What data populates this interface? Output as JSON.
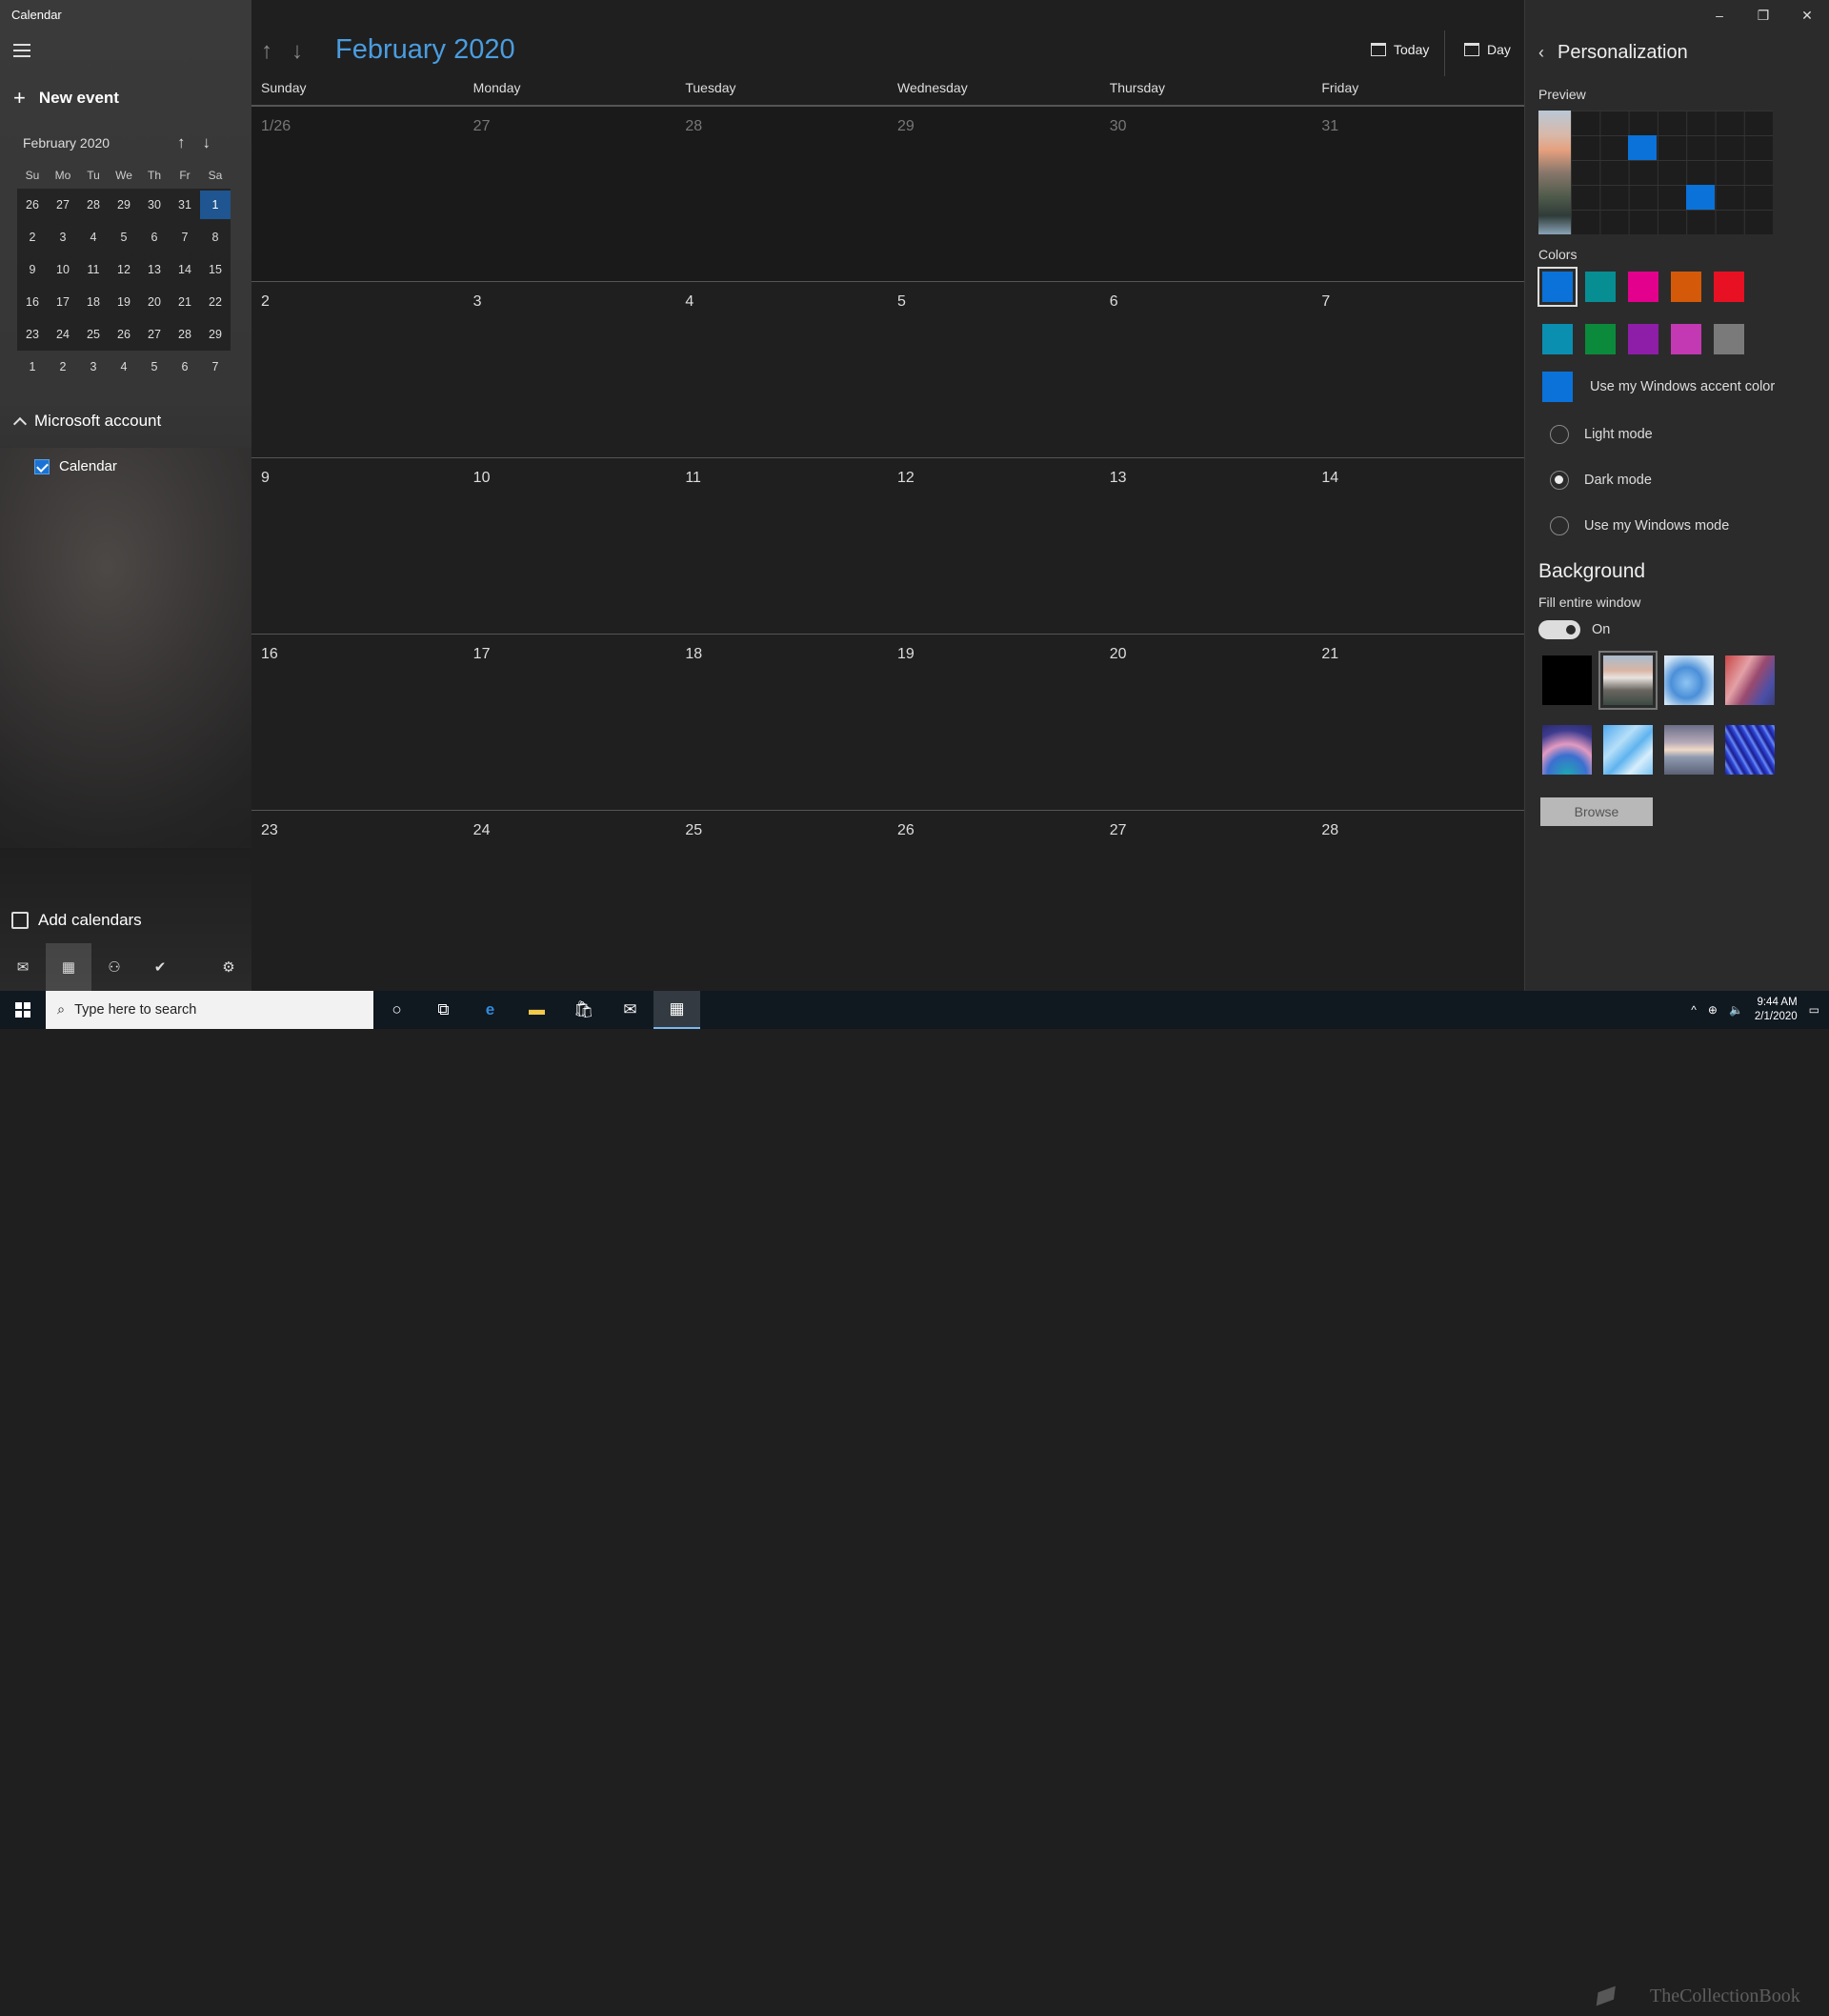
{
  "app": {
    "title": "Calendar"
  },
  "left": {
    "new_event": "New event",
    "mini_title": "February 2020",
    "weekday_abbr": [
      "Su",
      "Mo",
      "Tu",
      "We",
      "Th",
      "Fr",
      "Sa"
    ],
    "mini_weeks": [
      [
        "26",
        "27",
        "28",
        "29",
        "30",
        "31",
        "1"
      ],
      [
        "2",
        "3",
        "4",
        "5",
        "6",
        "7",
        "8"
      ],
      [
        "9",
        "10",
        "11",
        "12",
        "13",
        "14",
        "15"
      ],
      [
        "16",
        "17",
        "18",
        "19",
        "20",
        "21",
        "22"
      ],
      [
        "23",
        "24",
        "25",
        "26",
        "27",
        "28",
        "29"
      ],
      [
        "1",
        "2",
        "3",
        "4",
        "5",
        "6",
        "7"
      ]
    ],
    "account": "Microsoft account",
    "calendar_item": "Calendar",
    "add_calendars": "Add calendars"
  },
  "main": {
    "month_title": "February 2020",
    "today_label": "Today",
    "day_label": "Day",
    "weekdays": [
      "Sunday",
      "Monday",
      "Tuesday",
      "Wednesday",
      "Thursday",
      "Friday"
    ],
    "weeks": [
      [
        "1/26",
        "27",
        "28",
        "29",
        "30",
        "31"
      ],
      [
        "2",
        "3",
        "4",
        "5",
        "6",
        "7"
      ],
      [
        "9",
        "10",
        "11",
        "12",
        "13",
        "14"
      ],
      [
        "16",
        "17",
        "18",
        "19",
        "20",
        "21"
      ],
      [
        "23",
        "24",
        "25",
        "26",
        "27",
        "28"
      ]
    ]
  },
  "panel": {
    "title": "Personalization",
    "preview_label": "Preview",
    "colors_label": "Colors",
    "colors_row1": [
      "#0a72d8",
      "#068e93",
      "#e3008c",
      "#d45a0a",
      "#e81123"
    ],
    "colors_row2": [
      "#0a8fb0",
      "#0c8a3c",
      "#8e1ea8",
      "#c239b3",
      "#7a7a7a"
    ],
    "accent_color": "#0a72d8",
    "use_accent": "Use my Windows accent color",
    "light_mode": "Light mode",
    "dark_mode": "Dark mode",
    "windows_mode": "Use my Windows mode",
    "background_label": "Background",
    "fill_label": "Fill entire window",
    "toggle_label": "On",
    "browse": "Browse"
  },
  "taskbar": {
    "search_placeholder": "Type here to search",
    "time": "9:44 AM",
    "date": "2/1/2020",
    "watermark": "TheCollectionBook"
  }
}
